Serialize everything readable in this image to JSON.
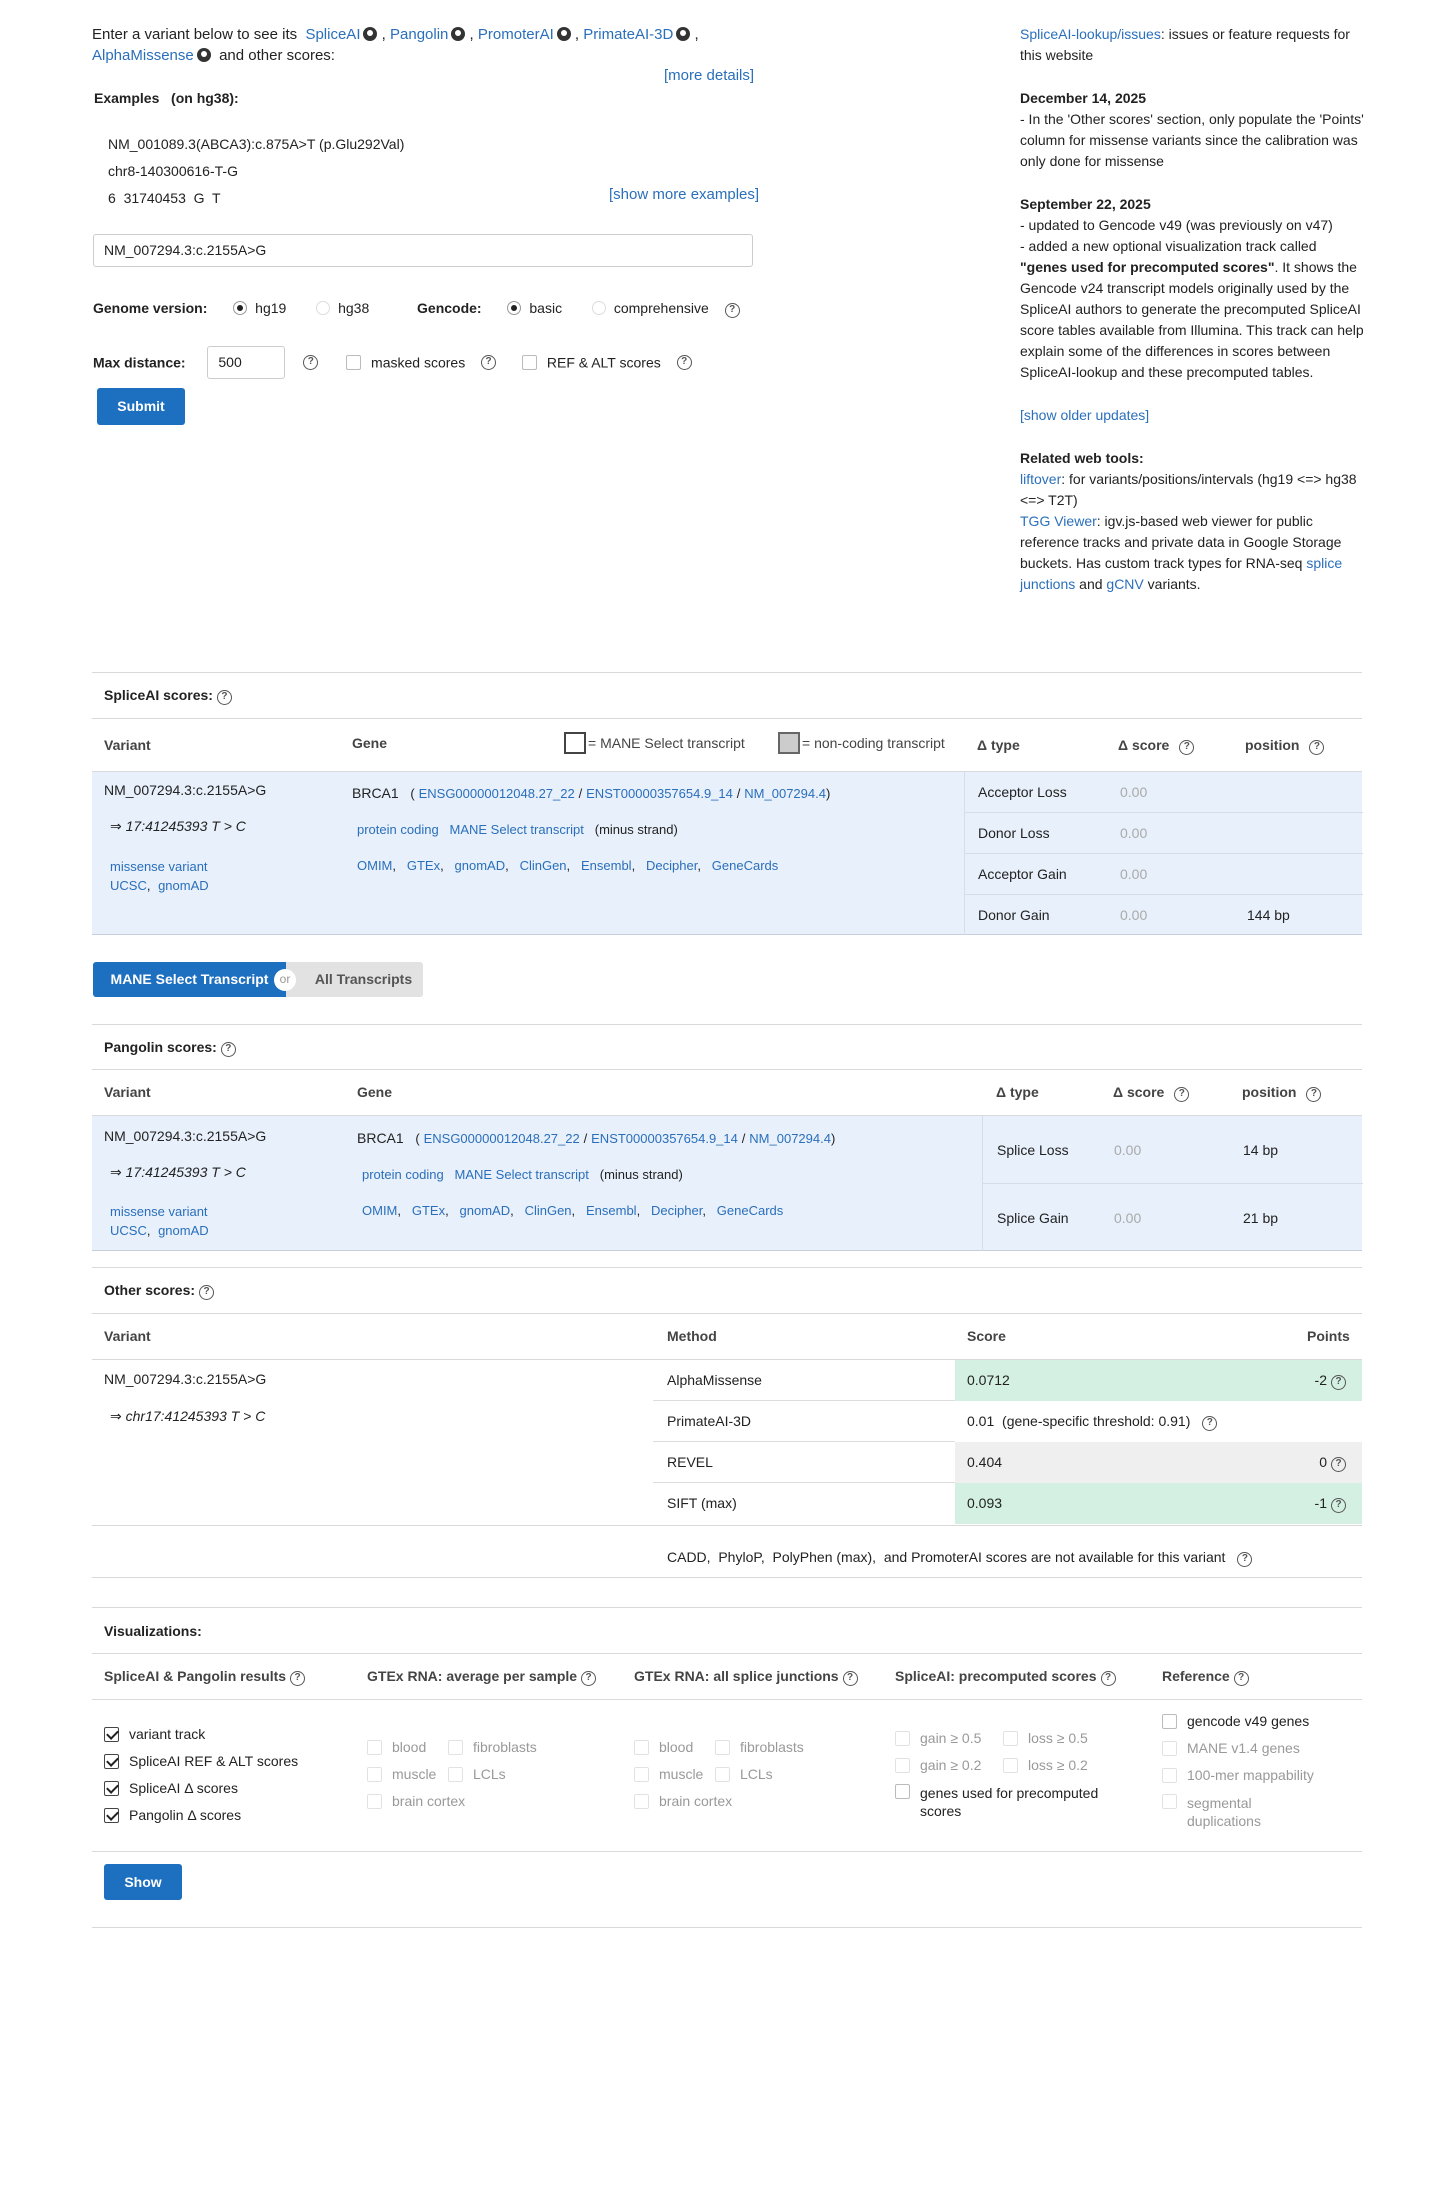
{
  "intro": {
    "prefix": "Enter a variant below to see its",
    "tools": [
      "SpliceAI",
      "Pangolin",
      "PromoterAI",
      "PrimateAI-3D",
      "AlphaMissense"
    ],
    "suffix": "and other scores:",
    "more_details": "[more details]"
  },
  "examples": {
    "title": "Examples",
    "build": "(on hg38):",
    "items": [
      "NM_001089.3(ABCA3):c.875A>T (p.Glu292Val)",
      "chr8-140300616-T-G",
      "6  31740453  G  T"
    ],
    "show_more": "[show more examples]"
  },
  "search": {
    "value": "NM_007294.3:c.2155A>G"
  },
  "options": {
    "genome_label": "Genome version:",
    "genome_opts": [
      "hg19",
      "hg38"
    ],
    "gencode_label": "Gencode:",
    "gencode_opts": [
      "basic",
      "comprehensive"
    ],
    "maxdist_label": "Max distance:",
    "maxdist_value": "500",
    "masked_label": "masked scores",
    "refalt_label": "REF & ALT scores",
    "submit": "Submit"
  },
  "news": {
    "issues_link": "SpliceAI-lookup/issues",
    "issues_text": ": issues or feature requests for this website",
    "d1": "December 14, 2025",
    "d1_text": "- In the 'Other scores' section, only populate the 'Points' column for missense variants since the calibration was only done for missense",
    "d2": "September 22, 2025",
    "d2_l1": "- updated to Gencode v49 (was previously on v47)",
    "d2_l2a": "- added a new optional visualization track called",
    "d2_l2b": "\"genes used for precomputed scores\"",
    "d2_l2c": ". It shows the Gencode v24 transcript models originally used by the SpliceAI authors to generate the precomputed SpliceAI score tables available from Illumina. This track can help explain some of the differences in scores between SpliceAI-lookup and these precomputed tables.",
    "older": "[show older updates]",
    "related_title": "Related web tools:",
    "liftover": "liftover",
    "liftover_text": ": for variants/positions/intervals (hg19 <=> hg38 <=> T2T)",
    "tgg": "TGG Viewer",
    "tgg_text": ": igv.js-based web viewer for public reference tracks and private data in Google Storage buckets. Has custom track types for RNA-seq",
    "splice_junctions": "splice junctions",
    "and": "and",
    "gcnv": "gCNV",
    "variants": "variants."
  },
  "spliceai": {
    "title": "SpliceAI scores:",
    "headers": {
      "variant": "Variant",
      "gene": "Gene",
      "mane_legend": "= MANE Select transcript",
      "noncoding_legend": "= non-coding transcript",
      "dtype": "Δ type",
      "dscore": "Δ score",
      "position": "position"
    },
    "variant": "NM_007294.3:c.2155A>G",
    "coord": "⇒ 17:41245393 T > C",
    "consequence": "missense variant",
    "ucsc": "UCSC",
    "gnomad": "gnomAD",
    "gene": "BRCA1",
    "ensg": "ENSG00000012048.27_22",
    "enst": "ENST00000357654.9_14",
    "nm": "NM_007294.4",
    "biotype": "protein coding",
    "mane": "MANE Select transcript",
    "strand": "(minus strand)",
    "links": [
      "OMIM",
      "GTEx",
      "gnomAD",
      "ClinGen",
      "Ensembl",
      "Decipher",
      "GeneCards"
    ],
    "rows": [
      {
        "type": "Acceptor Loss",
        "score": "0.00",
        "pos": ""
      },
      {
        "type": "Donor Loss",
        "score": "0.00",
        "pos": ""
      },
      {
        "type": "Acceptor Gain",
        "score": "0.00",
        "pos": ""
      },
      {
        "type": "Donor Gain",
        "score": "0.00",
        "pos": "144 bp"
      }
    ]
  },
  "toggle": {
    "mane": "MANE Select Transcript",
    "or": "or",
    "all": "All Transcripts"
  },
  "pangolin": {
    "title": "Pangolin scores:",
    "headers": {
      "variant": "Variant",
      "gene": "Gene",
      "dtype": "Δ type",
      "dscore": "Δ score",
      "position": "position"
    },
    "variant": "NM_007294.3:c.2155A>G",
    "coord": "⇒ 17:41245393 T > C",
    "rows": [
      {
        "type": "Splice Loss",
        "score": "0.00",
        "pos": "14 bp"
      },
      {
        "type": "Splice Gain",
        "score": "0.00",
        "pos": "21 bp"
      }
    ]
  },
  "other": {
    "title": "Other scores:",
    "headers": {
      "variant": "Variant",
      "method": "Method",
      "score": "Score",
      "points": "Points"
    },
    "variant": "NM_007294.3:c.2155A>G",
    "coord": "⇒ chr17:41245393 T > C",
    "rows": [
      {
        "method": "AlphaMissense",
        "score": "0.0712",
        "points": "-2",
        "color": "#d4f0e3"
      },
      {
        "method": "PrimateAI-3D",
        "score": "0.01  (gene-specific threshold: 0.91)",
        "points": "",
        "color": "#ffffff"
      },
      {
        "method": "REVEL",
        "score": "0.404",
        "points": "0",
        "color": "#efefef"
      },
      {
        "method": "SIFT (max)",
        "score": "0.093",
        "points": "-1",
        "color": "#d4f0e3"
      }
    ],
    "note": "CADD,  PhyloP,  PolyPhen (max),  and PromoterAI scores are not available for this variant"
  },
  "viz": {
    "title": "Visualizations:",
    "cols": [
      "SpliceAI & Pangolin results",
      "GTEx RNA: average per sample",
      "GTEx RNA: all splice junctions",
      "SpliceAI: precomputed scores",
      "Reference"
    ],
    "results": [
      "variant track",
      "SpliceAI REF & ALT scores",
      "SpliceAI Δ  scores",
      "Pangolin Δ  scores"
    ],
    "tissues": [
      "blood",
      "fibroblasts",
      "muscle",
      "LCLs",
      "brain cortex"
    ],
    "precomp": [
      "gain ≥ 0.5",
      "loss ≥ 0.5",
      "gain ≥ 0.2",
      "loss ≥ 0.2",
      "genes used for precomputed scores"
    ],
    "reference": [
      "gencode v49 genes",
      "MANE v1.4 genes",
      "100-mer mappability",
      "segmental duplications"
    ],
    "show": "Show"
  }
}
